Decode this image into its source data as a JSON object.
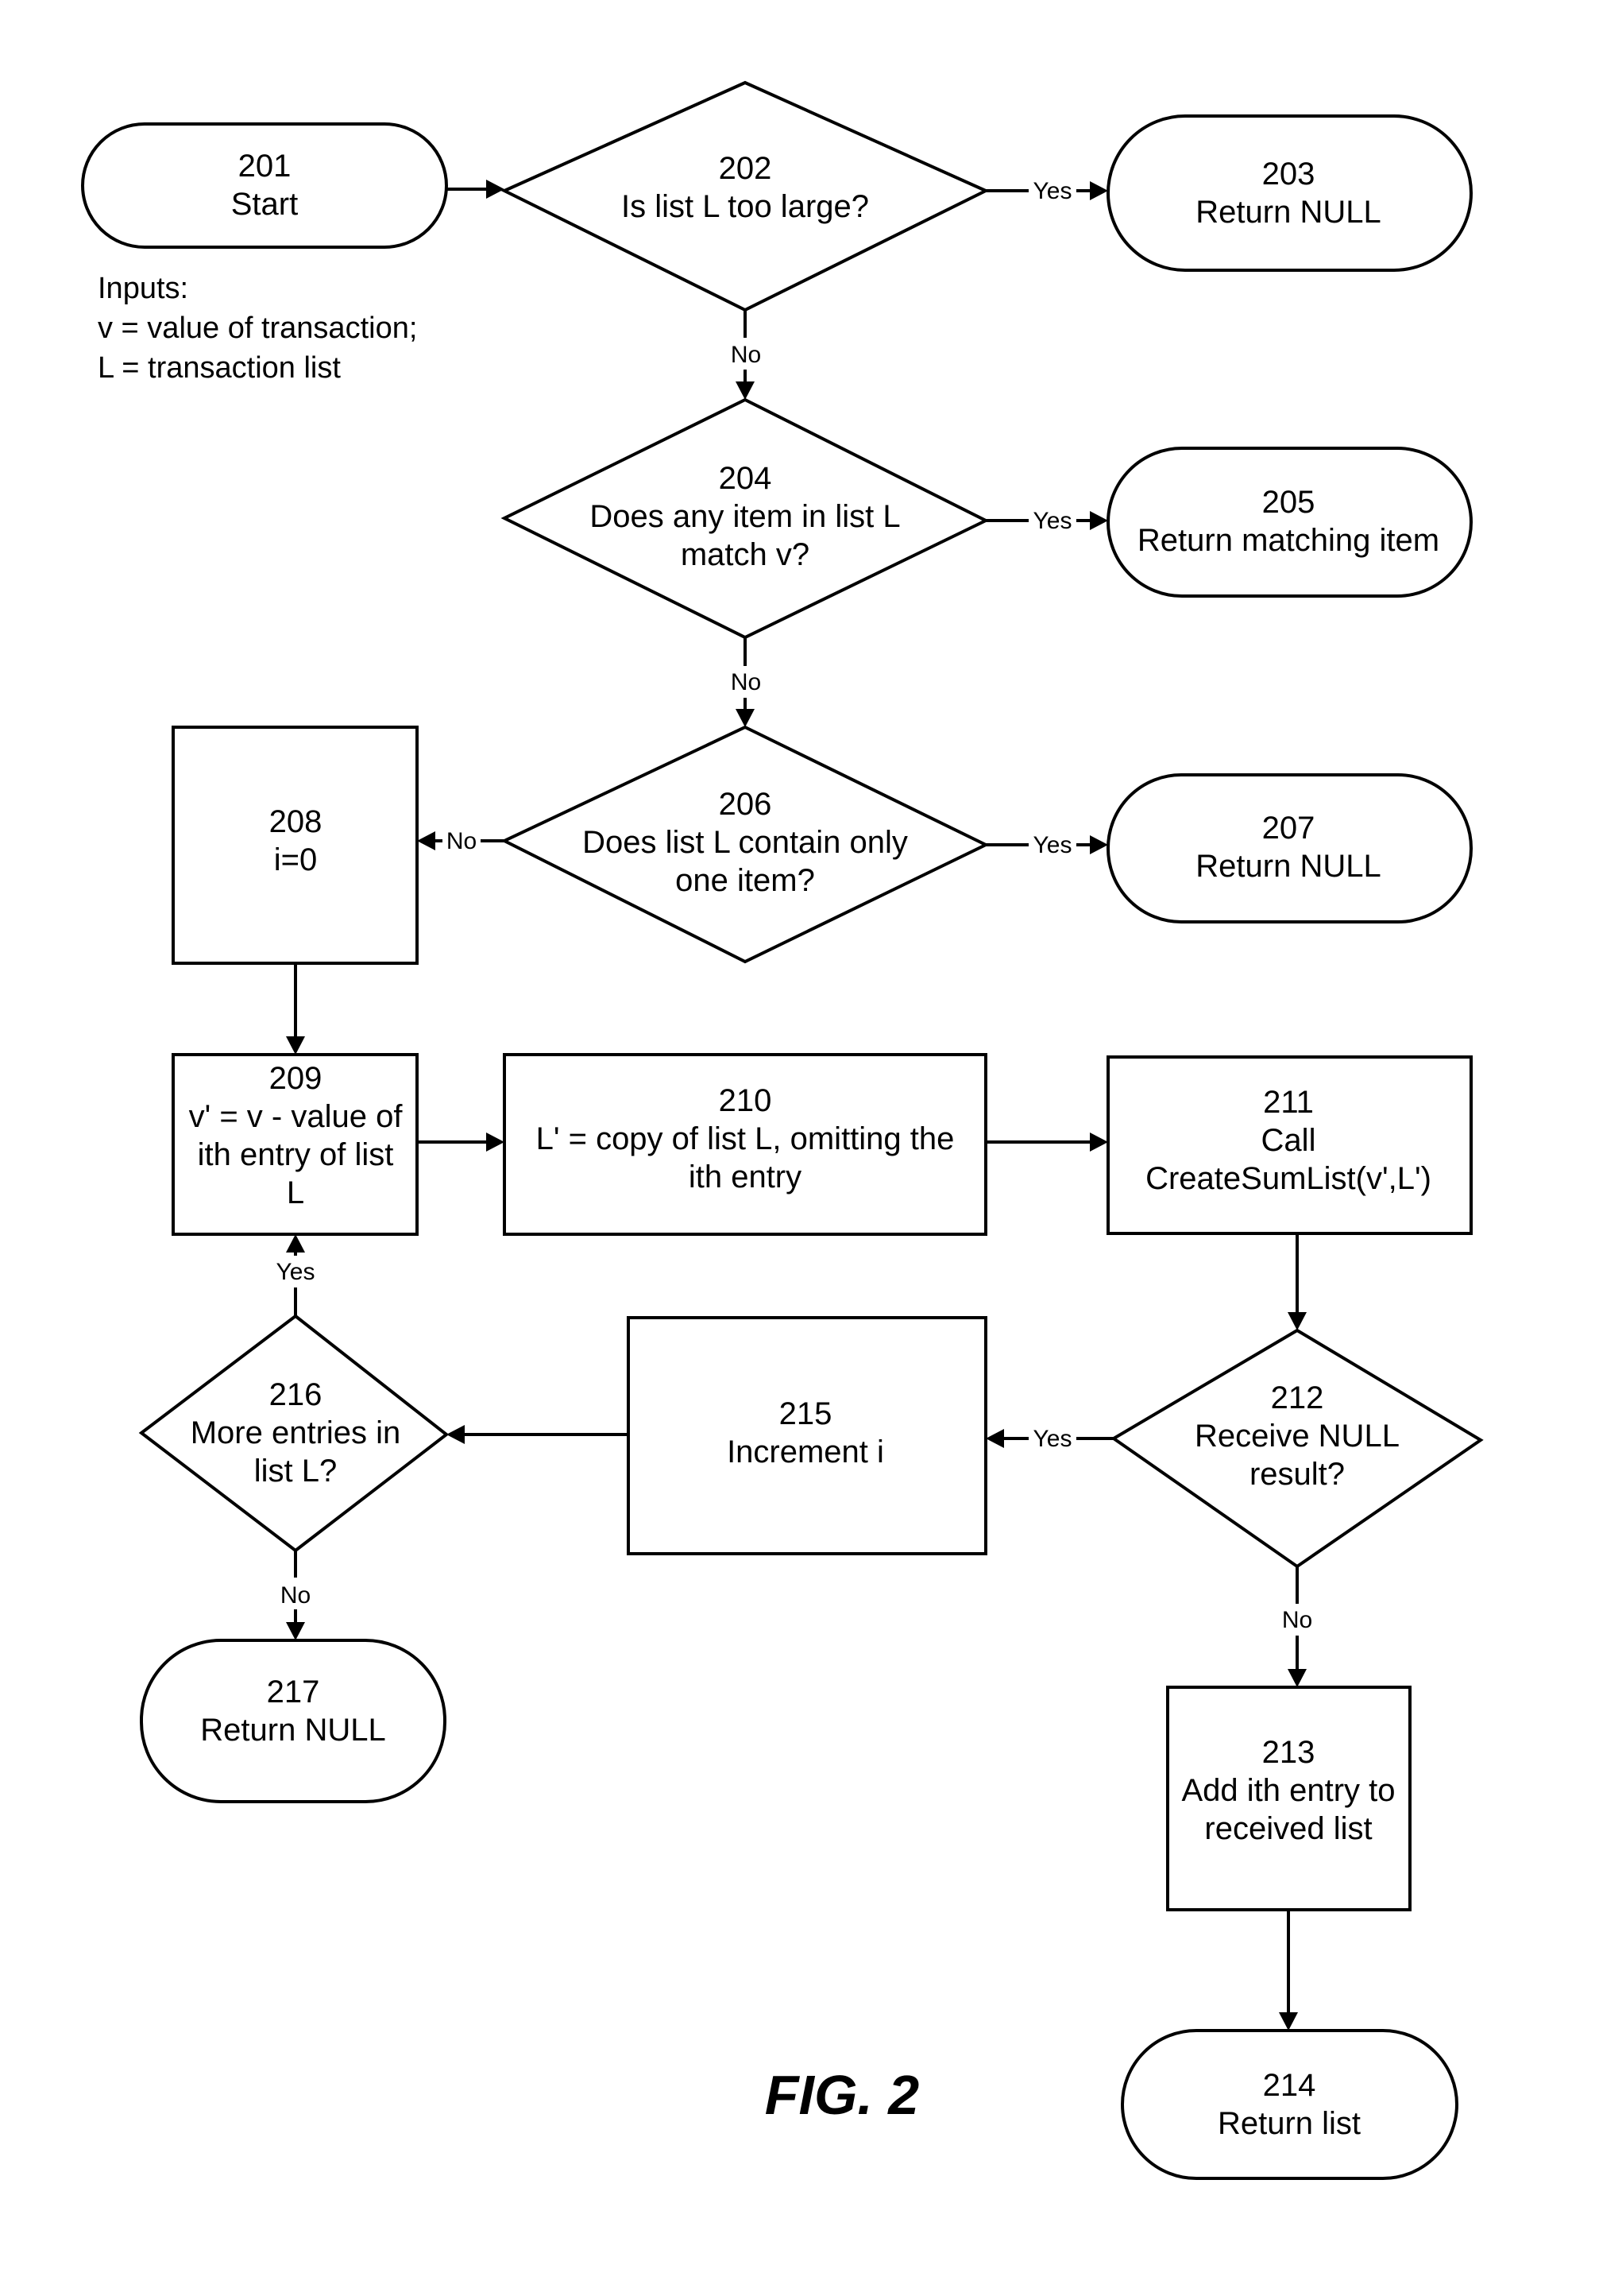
{
  "figure": {
    "caption": "FIG. 2",
    "inputs": {
      "title": "Inputs:",
      "lines": [
        "v = value of transaction;",
        "L = transaction list"
      ]
    },
    "nodes": {
      "n201": {
        "id": "201",
        "type": "terminal",
        "lines": [
          "201",
          "Start"
        ]
      },
      "n202": {
        "id": "202",
        "type": "decision",
        "lines": [
          "202",
          "Is list L too large?"
        ]
      },
      "n203": {
        "id": "203",
        "type": "terminal",
        "lines": [
          "203",
          "Return NULL"
        ]
      },
      "n204": {
        "id": "204",
        "type": "decision",
        "lines": [
          "204",
          "Does any item in list L",
          "match v?"
        ]
      },
      "n205": {
        "id": "205",
        "type": "terminal",
        "lines": [
          "205",
          "Return matching item"
        ]
      },
      "n206": {
        "id": "206",
        "type": "decision",
        "lines": [
          "206",
          "Does list L contain only",
          "one item?"
        ]
      },
      "n207": {
        "id": "207",
        "type": "terminal",
        "lines": [
          "207",
          "Return NULL"
        ]
      },
      "n208": {
        "id": "208",
        "type": "process",
        "lines": [
          "208",
          "i=0"
        ]
      },
      "n209": {
        "id": "209",
        "type": "process",
        "lines": [
          "209",
          "v' = v - value of",
          "ith entry of list",
          "L"
        ]
      },
      "n210": {
        "id": "210",
        "type": "process",
        "lines": [
          "210",
          "L' = copy of list L, omitting the",
          "ith entry"
        ]
      },
      "n211": {
        "id": "211",
        "type": "process",
        "lines": [
          "211",
          "Call",
          "CreateSumList(v',L')"
        ]
      },
      "n212": {
        "id": "212",
        "type": "decision",
        "lines": [
          "212",
          "Receive NULL",
          "result?"
        ]
      },
      "n213": {
        "id": "213",
        "type": "process",
        "lines": [
          "213",
          "Add ith entry to",
          "received list"
        ]
      },
      "n214": {
        "id": "214",
        "type": "terminal",
        "lines": [
          "214",
          "Return list"
        ]
      },
      "n215": {
        "id": "215",
        "type": "process",
        "lines": [
          "215",
          "Increment i"
        ]
      },
      "n216": {
        "id": "216",
        "type": "decision",
        "lines": [
          "216",
          "More entries in",
          "list L?"
        ]
      },
      "n217": {
        "id": "217",
        "type": "terminal",
        "lines": [
          "217",
          "Return NULL"
        ]
      }
    },
    "edges": {
      "e202_203": {
        "from": "202",
        "to": "203",
        "label": "Yes"
      },
      "e202_204": {
        "from": "202",
        "to": "204",
        "label": "No"
      },
      "e204_205": {
        "from": "204",
        "to": "205",
        "label": "Yes"
      },
      "e204_206": {
        "from": "204",
        "to": "206",
        "label": "No"
      },
      "e206_207": {
        "from": "206",
        "to": "207",
        "label": "Yes"
      },
      "e206_208": {
        "from": "206",
        "to": "208",
        "label": "No"
      },
      "e212_215": {
        "from": "212",
        "to": "215",
        "label": "Yes"
      },
      "e212_213": {
        "from": "212",
        "to": "213",
        "label": "No"
      },
      "e216_209": {
        "from": "216",
        "to": "209",
        "label": "Yes"
      },
      "e216_217": {
        "from": "216",
        "to": "217",
        "label": "No"
      },
      "e201_202": {
        "from": "201",
        "to": "202",
        "label": ""
      },
      "e208_209": {
        "from": "208",
        "to": "209",
        "label": ""
      },
      "e209_210": {
        "from": "209",
        "to": "210",
        "label": ""
      },
      "e210_211": {
        "from": "210",
        "to": "211",
        "label": ""
      },
      "e211_212": {
        "from": "211",
        "to": "212",
        "label": ""
      },
      "e215_216": {
        "from": "215",
        "to": "216",
        "label": ""
      },
      "e213_214": {
        "from": "213",
        "to": "214",
        "label": ""
      }
    }
  }
}
